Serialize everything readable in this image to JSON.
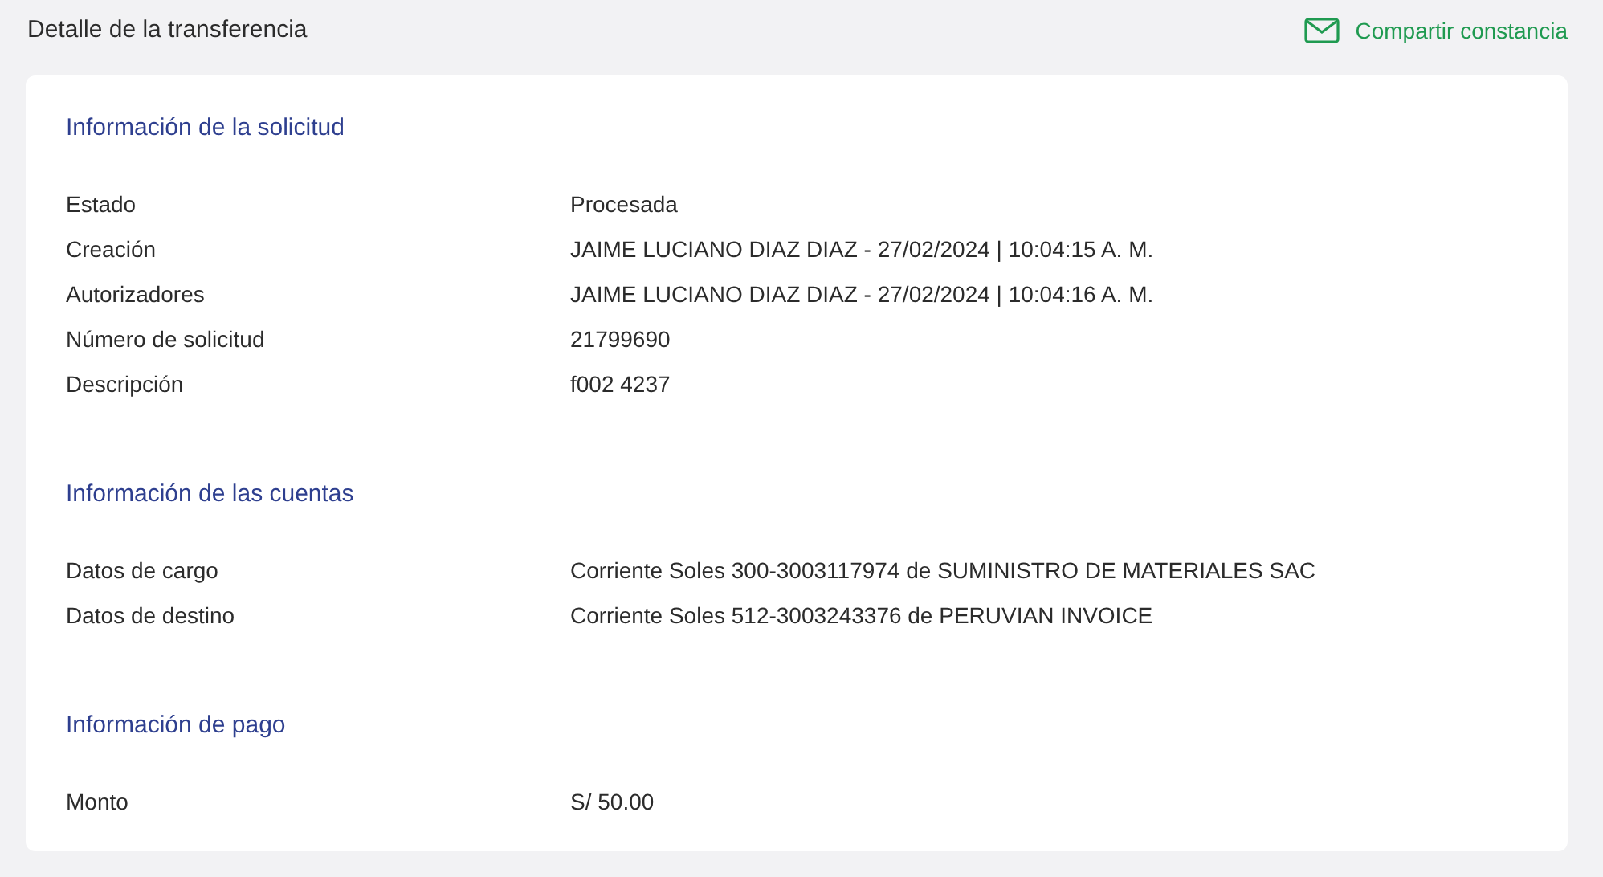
{
  "header": {
    "title": "Detalle de la transferencia",
    "share_link": "Compartir constancia"
  },
  "sections": [
    {
      "title": "Información de la solicitud",
      "rows": [
        {
          "label": "Estado",
          "value": "Procesada"
        },
        {
          "label": "Creación",
          "value": "JAIME LUCIANO DIAZ DIAZ - 27/02/2024 | 10:04:15 A. M."
        },
        {
          "label": "Autorizadores",
          "value": "JAIME LUCIANO DIAZ DIAZ - 27/02/2024 | 10:04:16 A. M."
        },
        {
          "label": "Número de solicitud",
          "value": "21799690"
        },
        {
          "label": "Descripción",
          "value": "f002 4237"
        }
      ]
    },
    {
      "title": "Información de las cuentas",
      "rows": [
        {
          "label": "Datos de cargo",
          "value": "Corriente Soles 300-3003117974 de SUMINISTRO DE MATERIALES SAC"
        },
        {
          "label": "Datos de destino",
          "value": "Corriente Soles 512-3003243376 de PERUVIAN INVOICE"
        }
      ]
    },
    {
      "title": "Información de pago",
      "rows": [
        {
          "label": "Monto",
          "value": "S/ 50.00"
        }
      ]
    }
  ]
}
